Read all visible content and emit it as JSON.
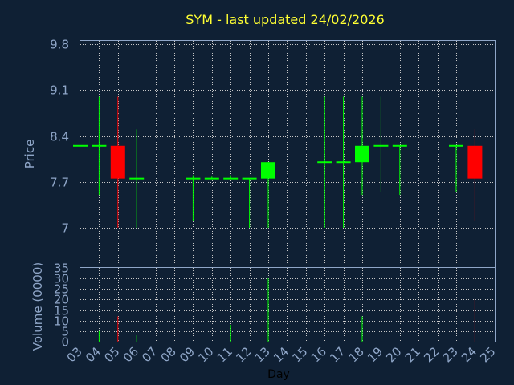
{
  "chart_data": {
    "type": "candlestick",
    "title": "SYM - last updated 24/02/2026",
    "xlabel": "Day",
    "x_ticks": [
      "03",
      "04",
      "05",
      "06",
      "07",
      "08",
      "09",
      "10",
      "11",
      "12",
      "13",
      "14",
      "15",
      "16",
      "17",
      "18",
      "19",
      "20",
      "21",
      "22",
      "23",
      "24",
      "25"
    ],
    "price_panel": {
      "ylabel": "Price",
      "ylim": [
        6.4,
        9.85
      ],
      "y_ticks": [
        "9.8",
        "9.1",
        "8.4",
        "7.7",
        "7"
      ],
      "candles": [
        {
          "day": "03",
          "open": 8.25,
          "high": 8.25,
          "low": 8.25,
          "close": 8.25
        },
        {
          "day": "04",
          "open": 8.25,
          "high": 9.0,
          "low": 7.5,
          "close": 8.25
        },
        {
          "day": "05",
          "open": 8.25,
          "high": 9.0,
          "low": 7.0,
          "close": 7.75
        },
        {
          "day": "06",
          "open": 7.75,
          "high": 8.5,
          "low": 7.0,
          "close": 7.75
        },
        {
          "day": "09",
          "open": 7.75,
          "high": 7.8,
          "low": 7.1,
          "close": 7.75
        },
        {
          "day": "10",
          "open": 7.75,
          "high": 7.78,
          "low": 7.75,
          "close": 7.75
        },
        {
          "day": "11",
          "open": 7.75,
          "high": 7.8,
          "low": 7.75,
          "close": 7.75
        },
        {
          "day": "12",
          "open": 7.75,
          "high": 7.75,
          "low": 7.0,
          "close": 7.75
        },
        {
          "day": "13",
          "open": 7.75,
          "high": 8.0,
          "low": 7.0,
          "close": 8.0
        },
        {
          "day": "16",
          "open": 8.0,
          "high": 9.0,
          "low": 7.0,
          "close": 8.0
        },
        {
          "day": "17",
          "open": 8.0,
          "high": 9.0,
          "low": 7.0,
          "close": 8.0
        },
        {
          "day": "18",
          "open": 8.0,
          "high": 9.0,
          "low": 7.5,
          "close": 8.25
        },
        {
          "day": "19",
          "open": 8.25,
          "high": 9.0,
          "low": 7.55,
          "close": 8.25
        },
        {
          "day": "20",
          "open": 8.25,
          "high": 8.25,
          "low": 7.5,
          "close": 8.25
        },
        {
          "day": "23",
          "open": 8.25,
          "high": 8.25,
          "low": 7.55,
          "close": 8.25
        },
        {
          "day": "24",
          "open": 8.25,
          "high": 8.5,
          "low": 7.1,
          "close": 7.75
        }
      ]
    },
    "volume_panel": {
      "ylabel": "Volume (0000)",
      "ylim": [
        0,
        35
      ],
      "y_ticks": [
        "35",
        "30",
        "25",
        "20",
        "15",
        "10",
        "5",
        "0"
      ],
      "bars": [
        {
          "day": "04",
          "value": 5,
          "direction": "up"
        },
        {
          "day": "05",
          "value": 12,
          "direction": "down"
        },
        {
          "day": "06",
          "value": 3,
          "direction": "up"
        },
        {
          "day": "11",
          "value": 8,
          "direction": "up"
        },
        {
          "day": "13",
          "value": 30,
          "direction": "up"
        },
        {
          "day": "18",
          "value": 12,
          "direction": "up"
        },
        {
          "day": "24",
          "value": 20,
          "direction": "down"
        }
      ]
    },
    "colors": {
      "background": "#0f2034",
      "up": "#00ff00",
      "down": "#ff0000",
      "title": "#ffff33",
      "axis_text": "#8fa6c8",
      "grid": "#c8c8c8"
    }
  }
}
